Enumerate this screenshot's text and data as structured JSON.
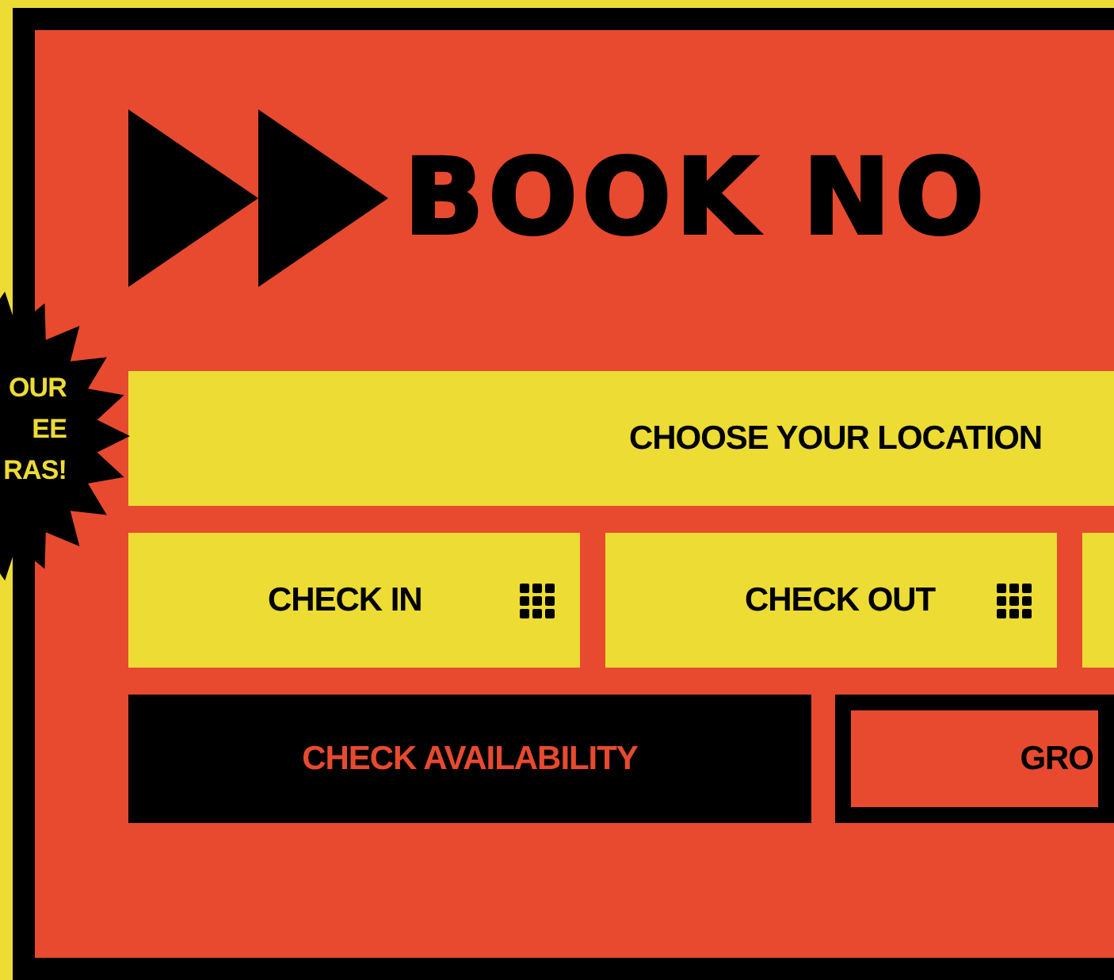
{
  "badge": {
    "lines": [
      "OUR",
      "EE",
      "RAS!"
    ]
  },
  "heading": {
    "title": "BOOK NO"
  },
  "location_field": {
    "label": "CHOOSE YOUR LOCATION"
  },
  "date_fields": [
    {
      "label": "CHECK IN"
    },
    {
      "label": "CHECK OUT"
    }
  ],
  "buttons": [
    {
      "label": "CHECK AVAILABILITY",
      "kind": "solid"
    },
    {
      "label": "GRO",
      "kind": "outline"
    }
  ]
}
